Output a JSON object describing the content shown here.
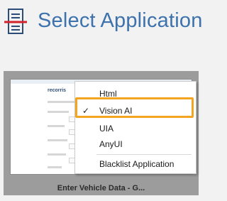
{
  "header": {
    "title": "Select Application",
    "icon": "application-list-icon",
    "accent_color": "#3d72ad",
    "icon_red": "#d3222a"
  },
  "card": {
    "label": "Enter Vehicle Data - G...",
    "thumbnail_logo": "recorris"
  },
  "context_menu": {
    "items": [
      {
        "label": "Html",
        "checked": false
      },
      {
        "label": "Vision AI",
        "checked": true,
        "highlighted": true
      },
      {
        "label": "UIA",
        "checked": false
      },
      {
        "label": "AnyUI",
        "checked": false
      },
      {
        "label": "Blacklist Application",
        "checked": false
      }
    ],
    "check_glyph": "✓",
    "highlight_color": "#f3a522"
  }
}
